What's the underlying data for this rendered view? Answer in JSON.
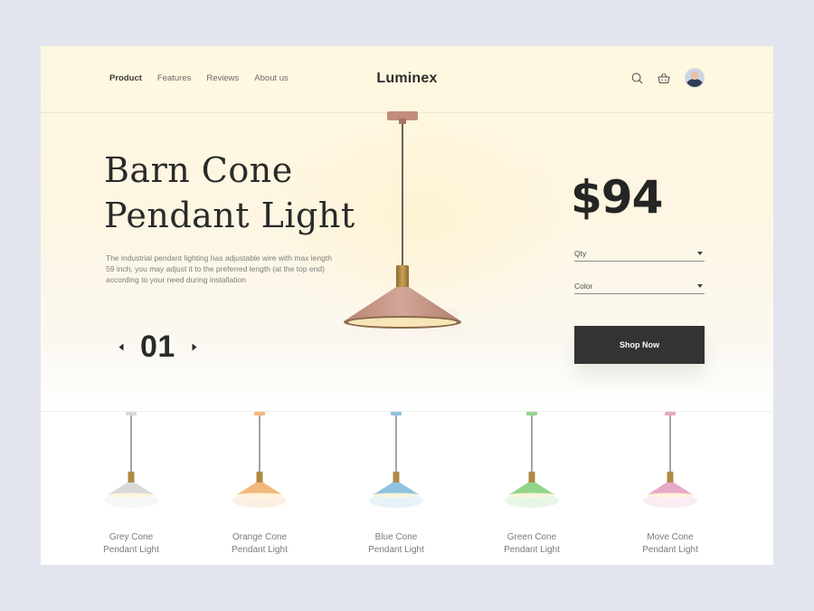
{
  "brand": "Luminex",
  "nav": [
    "Product",
    "Features",
    "Reviews",
    "About us"
  ],
  "header_icons": [
    "search-icon",
    "basket-icon",
    "avatar"
  ],
  "hero": {
    "title_line1": "Barn Cone",
    "title_line2": "Pendant Light",
    "description": "The industrial pendant lighting has adjustable wire with max length 59 inch, you may adjust it to the preferred length (at the top end) according to your need during installation",
    "slide_number": "01",
    "price": "$94",
    "qty_label": "Qty",
    "color_label": "Color",
    "cta": "Shop Now"
  },
  "products": [
    {
      "line1": "Grey Cone",
      "line2": "Pendant Light",
      "color": "#d9d9d9"
    },
    {
      "line1": "Orange Cone",
      "line2": "Pendant Light",
      "color": "#f2b77a"
    },
    {
      "line1": "Blue Cone",
      "line2": "Pendant Light",
      "color": "#8fc3e0"
    },
    {
      "line1": "Green Cone",
      "line2": "Pendant Light",
      "color": "#92d58a"
    },
    {
      "line1": "Move Cone",
      "line2": "Pendant Light",
      "color": "#e8a9c6"
    }
  ],
  "colors": {
    "background": "#e3e5ee",
    "hero_bg": "#fff8e0",
    "button": "#333333",
    "lamp_shade": "#c99a8a",
    "lamp_brass": "#b38a3f"
  }
}
